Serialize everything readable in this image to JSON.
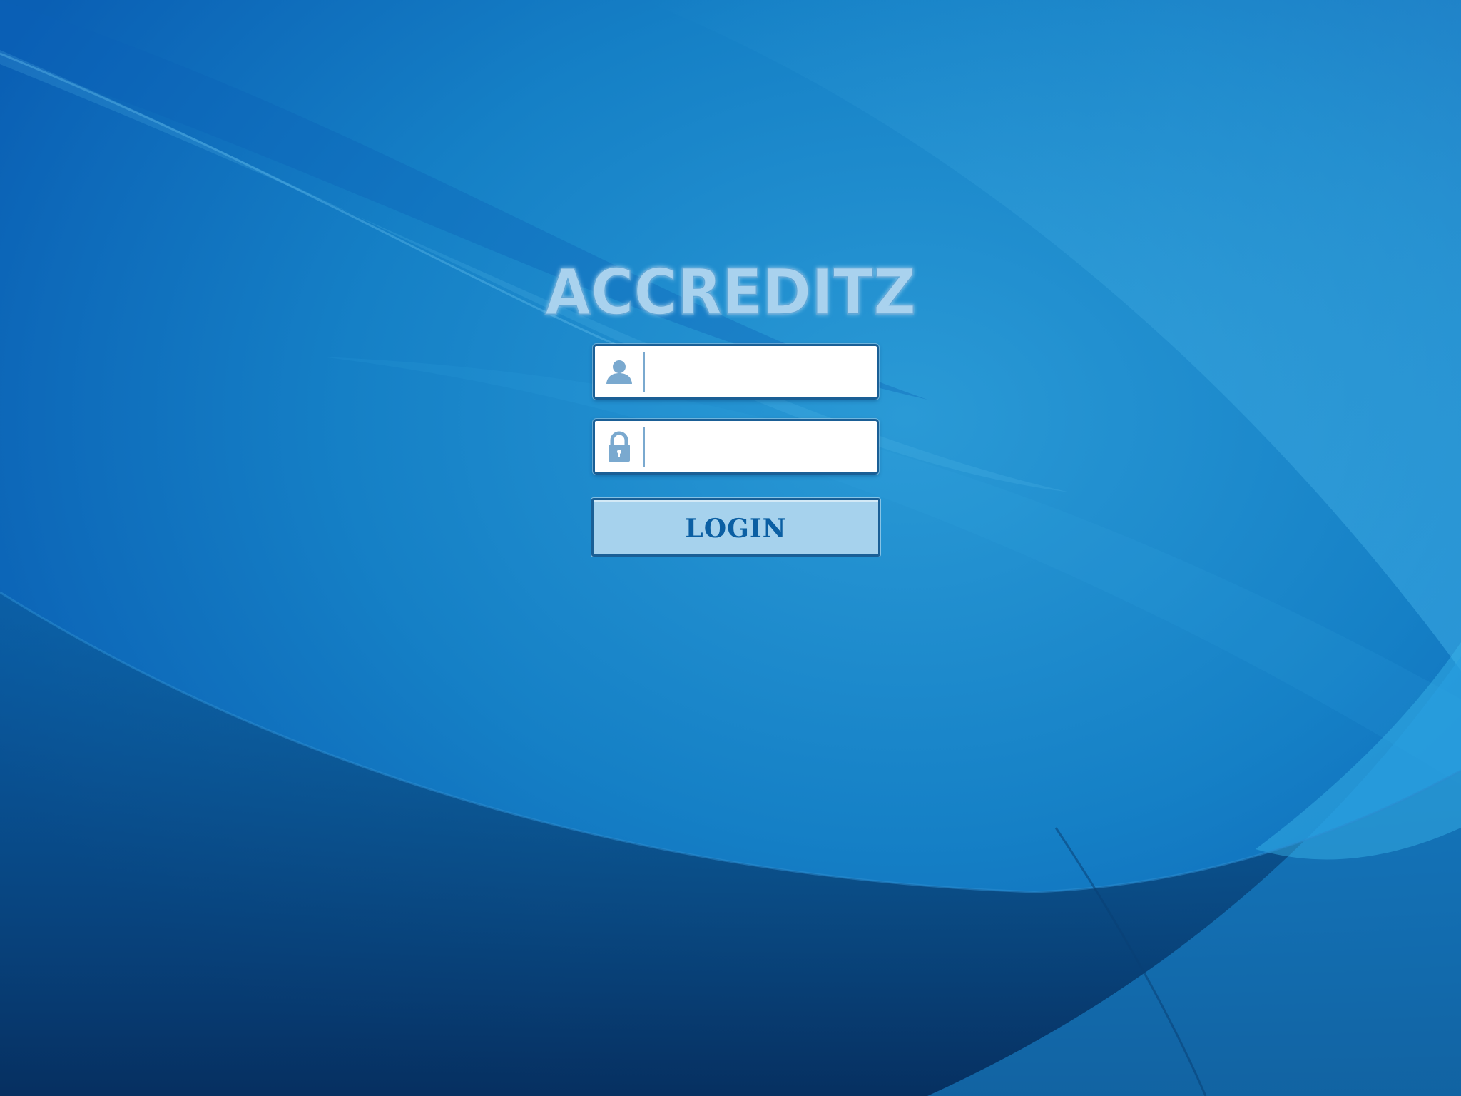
{
  "brand": {
    "logo_text": "ACCREDITZ",
    "logo_color": "#a9d2ee"
  },
  "form": {
    "username": {
      "icon": "user-icon",
      "value": "",
      "placeholder": ""
    },
    "password": {
      "icon": "lock-icon",
      "value": "",
      "placeholder": ""
    },
    "login_label": "LOGIN"
  },
  "colors": {
    "background": "#1380c8",
    "field_border": "#1a5f96",
    "button_fill": "#a6d2ed",
    "button_text": "#0b5fa3",
    "icon": "#7aa9cf"
  }
}
